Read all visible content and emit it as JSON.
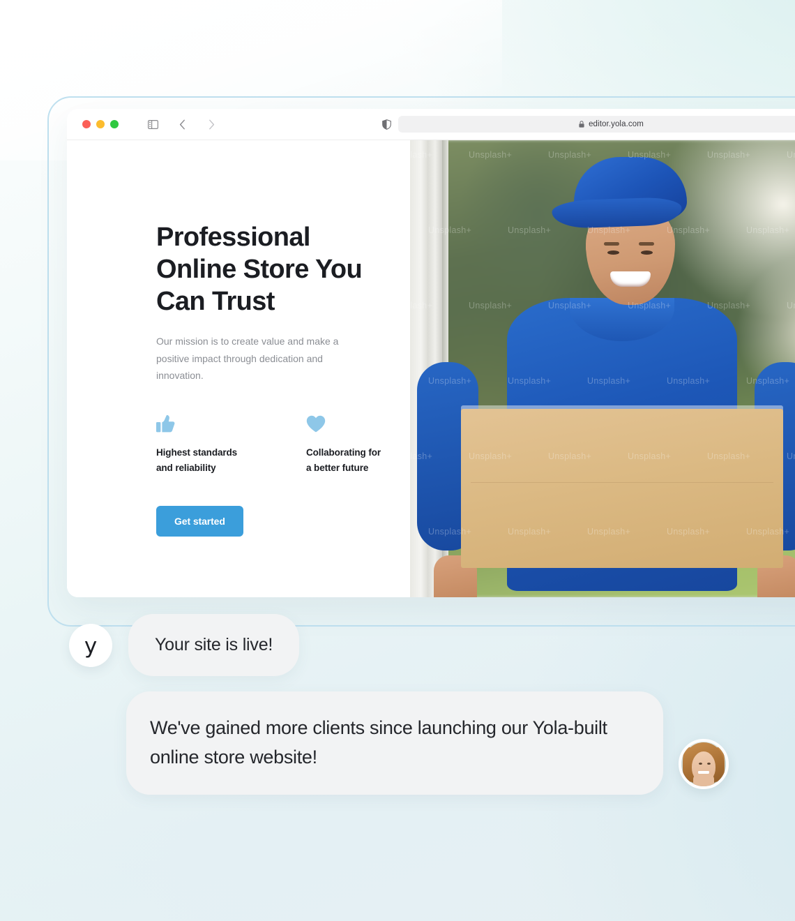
{
  "browser": {
    "url": "editor.yola.com",
    "lock_icon": "lock-icon",
    "reload_icon": "reload-icon",
    "shield_icon": "shield-icon",
    "sidebar_icon": "sidebar-toggle-icon",
    "back_icon": "chevron-left-icon",
    "forward_icon": "chevron-right-icon",
    "traffic_lights": [
      "close-red",
      "minimize-yellow",
      "zoom-green"
    ]
  },
  "site": {
    "headline": "Professional\nOnline Store You\nCan Trust",
    "subcopy": "Our mission is to create value and make a positive impact through dedication and innovation.",
    "features": [
      {
        "icon": "thumbs-up-icon",
        "label": "Highest standards\nand reliability"
      },
      {
        "icon": "heart-icon",
        "label": "Collaborating for\na better future"
      }
    ],
    "cta_label": "Get started",
    "hero_image_alt": "Smiling delivery man in blue cap and polo shirt holding a cardboard box",
    "hero_watermark": "Unsplash+"
  },
  "chat": {
    "brand_avatar_letter": "y",
    "messages": [
      {
        "text": "Your site is live!"
      },
      {
        "text": "We've gained more clients since launching our Yola-built online store website!"
      }
    ]
  },
  "colors": {
    "accent_blue": "#3b9edb",
    "icon_blue": "#8ec7e8",
    "bubble_bg": "#f2f3f4",
    "frame_stroke": "#bfe0ef",
    "heading": "#1b1d22",
    "body_text": "#8b8e94"
  }
}
